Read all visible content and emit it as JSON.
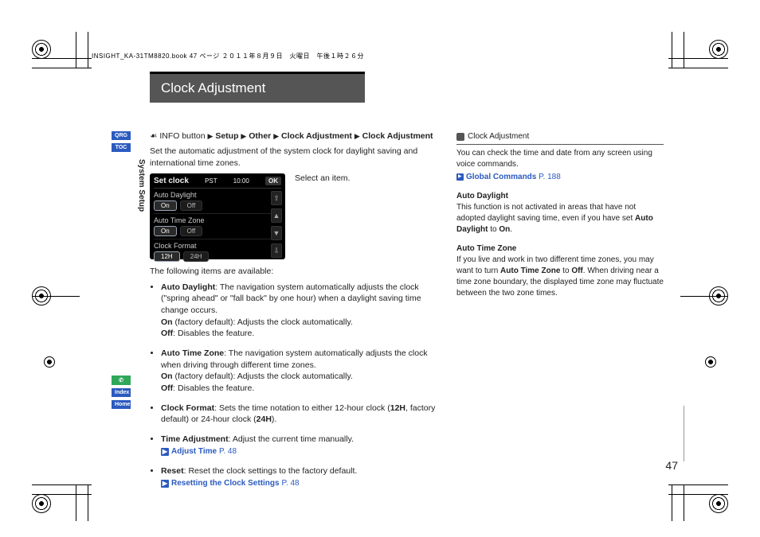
{
  "header_strip": "INSIGHT_KA-31TM8820.book  47 ページ  ２０１１年８月９日　火曜日　午後１時２６分",
  "title": "Clock Adjustment",
  "vertical_label": "System Setup",
  "sidebar": {
    "tabs_top": [
      "QRG",
      "TOC"
    ],
    "tabs_bottom_green": "✆",
    "tabs_bottom": [
      "Index",
      "Home"
    ]
  },
  "breadcrumb": {
    "icon": "☙",
    "prefix": "INFO button",
    "items": [
      "Setup",
      "Other",
      "Clock Adjustment",
      "Clock Adjustment"
    ]
  },
  "intro": "Set the automatic adjustment of the system clock for daylight saving and international time zones.",
  "screen": {
    "title": "Set clock",
    "zone": "PST",
    "time": "10:00",
    "ok": "OK",
    "rows": [
      {
        "label": "Auto Daylight",
        "opts": [
          "On",
          "Off"
        ],
        "active": 0
      },
      {
        "label": "Auto Time Zone",
        "opts": [
          "On",
          "Off"
        ],
        "active": 0
      },
      {
        "label": "Clock Format",
        "opts": [
          "12H",
          "24H"
        ],
        "active": 0
      }
    ],
    "side": [
      "⇧",
      "▲",
      "▼",
      "⇩"
    ]
  },
  "select_item": "Select an item.",
  "following": "The following items are available:",
  "items": [
    {
      "name": "Auto Daylight",
      "desc": ": The navigation system automatically adjusts the clock (\"spring ahead\" or \"fall back\" by one hour) when a daylight saving time change occurs.",
      "on": " (factory default): Adjusts the clock automatically.",
      "off": ": Disables the feature."
    },
    {
      "name": "Auto Time Zone",
      "desc": ": The navigation system automatically adjusts the clock when driving through different time zones.",
      "on": " (factory default): Adjusts the clock automatically.",
      "off": ": Disables the feature."
    },
    {
      "name": "Clock Format",
      "desc_a": ": Sets the time notation to either 12-hour clock (",
      "mid1": "12H",
      "desc_b": ", factory default) or 24-hour clock (",
      "mid2": "24H",
      "desc_c": ")."
    },
    {
      "name": "Time Adjustment",
      "desc": ": Adjust the current time manually.",
      "link": "Adjust Time",
      "page": "P. 48"
    },
    {
      "name": "Reset",
      "desc": ": Reset the clock settings to the factory default.",
      "link": "Resetting the Clock Settings",
      "page": "P. 48"
    }
  ],
  "side": {
    "heading": "Clock Adjustment",
    "body1": "You can check the time and date from any screen using voice commands.",
    "link": "Global Commands",
    "link_page": "P. 188",
    "sub1_title": "Auto Daylight",
    "sub1_body_a": "This function is not activated in areas that have not adopted daylight saving time, even if you have set ",
    "sub1_body_bold": "Auto Daylight",
    "sub1_body_b": " to ",
    "sub1_body_bold2": "On",
    "sub1_body_c": ".",
    "sub2_title": "Auto Time Zone",
    "sub2_body_a": "If you live and work in two different time zones, you may want to turn ",
    "sub2_body_bold": "Auto Time Zone",
    "sub2_body_b": " to ",
    "sub2_body_bold2": "Off",
    "sub2_body_c": ". When driving near a time zone boundary, the displayed time zone may fluctuate between the two zone times."
  },
  "page_number": "47"
}
